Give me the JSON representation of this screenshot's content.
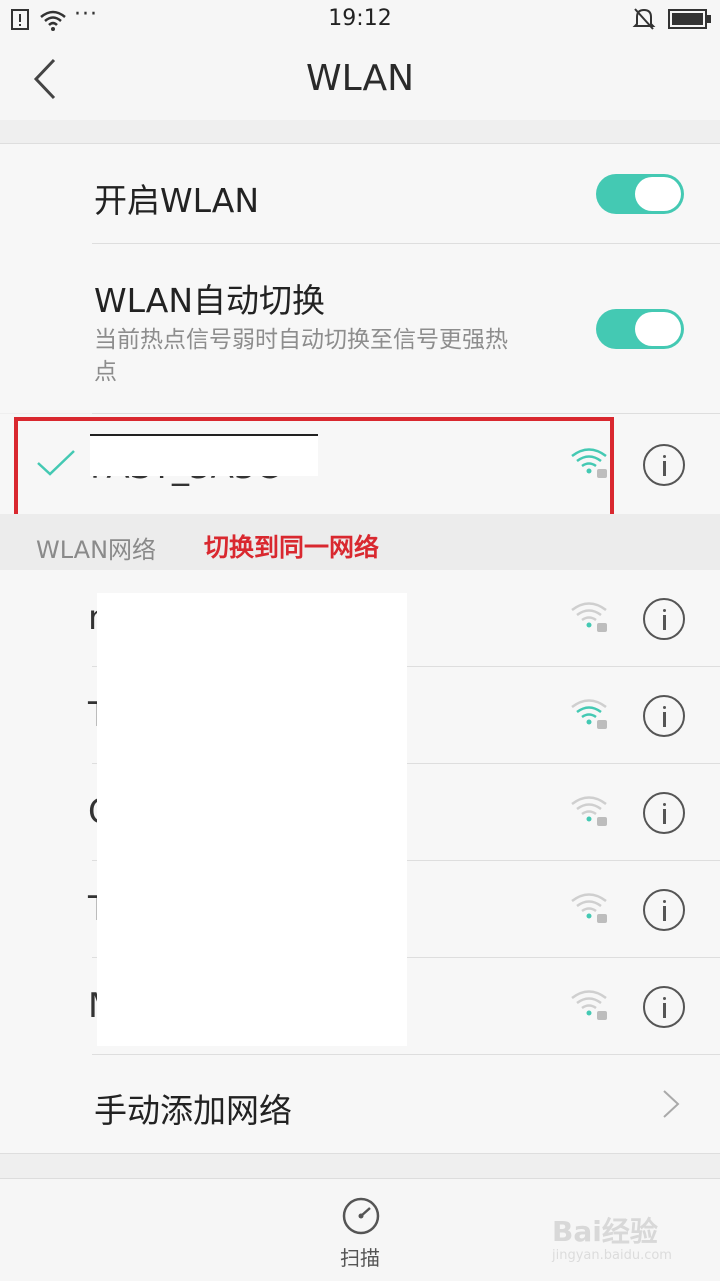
{
  "status": {
    "time": "19:12",
    "dots": "···"
  },
  "header": {
    "title": "WLAN"
  },
  "wlan_toggle": {
    "label": "开启WLAN",
    "on": true
  },
  "auto_switch": {
    "label": "WLAN自动切换",
    "desc_line1": "当前热点信号弱时自动切换至信号更强热",
    "desc_line2": "点",
    "on": true
  },
  "connected": {
    "ssid": "FAST_3A3C"
  },
  "section": {
    "label": "WLAN网络",
    "annotation": "切换到同一网络"
  },
  "networks": [
    {
      "letter": "n"
    },
    {
      "letter": "T"
    },
    {
      "letter": "C"
    },
    {
      "letter": "T"
    },
    {
      "letter": "M"
    }
  ],
  "manual_add": {
    "label": "手动添加网络"
  },
  "bottom": {
    "scan_label": "扫描"
  },
  "watermark": {
    "brand": "Bai经验",
    "url": "jingyan.baidu.com"
  },
  "colors": {
    "accent": "#44c9b3",
    "annotation": "#d9282f"
  },
  "icons": {
    "back": "chevron-left-icon",
    "wifi": "wifi-lock-icon",
    "info": "info-icon",
    "scan": "speedometer-icon"
  }
}
